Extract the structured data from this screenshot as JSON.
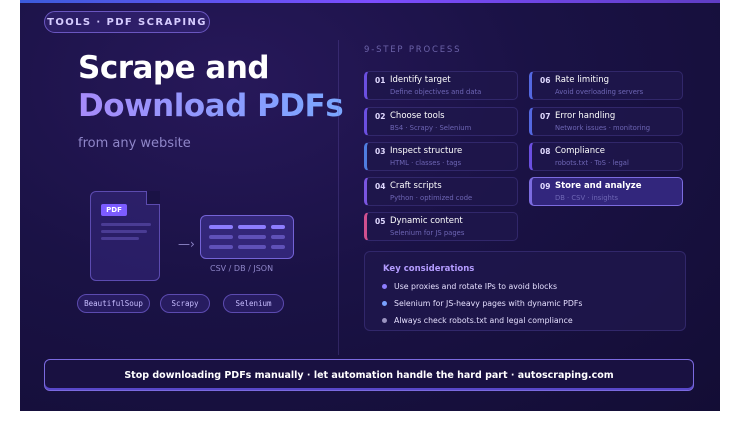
{
  "badge": "TOOLS · PDF SCRAPING",
  "headline": {
    "line1": "Scrape and",
    "line2": "Download PDFs",
    "sub": "from any website"
  },
  "illustration": {
    "pdf_badge": "PDF",
    "output_label": "CSV / DB / JSON"
  },
  "libraries": [
    "BeautifulSoup",
    "Scrapy",
    "Selenium"
  ],
  "process": {
    "title": "9-STEP PROCESS",
    "steps": [
      {
        "num": "01",
        "title": "Identify target",
        "desc": "Define objectives and data",
        "color": "#6b4fe0"
      },
      {
        "num": "02",
        "title": "Choose tools",
        "desc": "BS4 · Scrapy · Selenium",
        "color": "#6b4fe0"
      },
      {
        "num": "03",
        "title": "Inspect structure",
        "desc": "HTML · classes · tags",
        "color": "#4f7de0"
      },
      {
        "num": "04",
        "title": "Craft scripts",
        "desc": "Python · optimized code",
        "color": "#7a55e0"
      },
      {
        "num": "05",
        "title": "Dynamic content",
        "desc": "Selenium for JS pages",
        "color": "#d0508f"
      },
      {
        "num": "06",
        "title": "Rate limiting",
        "desc": "Avoid overloading servers",
        "color": "#5468e0"
      },
      {
        "num": "07",
        "title": "Error handling",
        "desc": "Network issues · monitoring",
        "color": "#5468e0"
      },
      {
        "num": "08",
        "title": "Compliance",
        "desc": "robots.txt · ToS · legal",
        "color": "#6b4fe0"
      },
      {
        "num": "09",
        "title": "Store and analyze",
        "desc": "DB · CSV · insights",
        "color": "#7c6ce0"
      }
    ]
  },
  "considerations": {
    "title": "Key considerations",
    "items": [
      {
        "text": "Use proxies and rotate IPs to avoid blocks",
        "color": "#8d7dff"
      },
      {
        "text": "Selenium for JS-heavy pages with dynamic PDFs",
        "color": "#7aa2ff"
      },
      {
        "text": "Always check robots.txt and legal compliance",
        "color": "#9a93c0"
      }
    ]
  },
  "footer": "Stop downloading PDFs manually · let automation handle the hard part · autoscraping.com"
}
